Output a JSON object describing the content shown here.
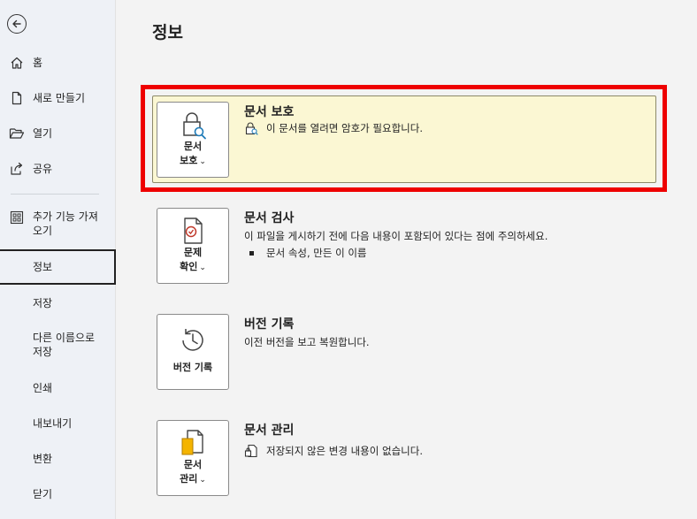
{
  "sidebar": {
    "items": [
      {
        "label": "홈",
        "icon": "home-icon"
      },
      {
        "label": "새로 만들기",
        "icon": "new-document-icon"
      },
      {
        "label": "열기",
        "icon": "open-folder-icon"
      },
      {
        "label": "공유",
        "icon": "share-icon"
      },
      {
        "label": "추가 기능 가져오기",
        "line1": "추가 기능 가져",
        "line2": "오기",
        "icon": "add-ins-icon"
      },
      {
        "label": "정보"
      },
      {
        "label": "저장"
      },
      {
        "label": "다른 이름으로 저장",
        "line1": "다른 이름으로",
        "line2": "저장"
      },
      {
        "label": "인쇄"
      },
      {
        "label": "내보내기"
      },
      {
        "label": "변환"
      },
      {
        "label": "닫기"
      }
    ]
  },
  "main": {
    "title": "정보",
    "sections": [
      {
        "title": "문서 보호",
        "description": "이 문서를 열려면 암호가 필요합니다.",
        "tile_line1": "문서",
        "tile_line2": "보호",
        "icon": "lock-icon",
        "highlighted": true
      },
      {
        "title": "문서 검사",
        "description": "이 파일을 게시하기 전에 다음 내용이 포함되어 있다는 점에 주의하세요.",
        "bullet": "문서 속성, 만든 이 이름",
        "tile_line1": "문제",
        "tile_line2": "확인",
        "icon": "inspect-document-icon"
      },
      {
        "title": "버전 기록",
        "description": "이전 버전을 보고 복원합니다.",
        "tile_line1": "버전 기록",
        "icon": "history-icon"
      },
      {
        "title": "문서 관리",
        "description": "저장되지 않은 변경 내용이 없습니다.",
        "tile_line1": "문서",
        "tile_line2": "관리",
        "icon": "manage-document-icon"
      }
    ]
  },
  "colors": {
    "highlight_bg": "#fbf7d3",
    "red_frame": "#ee0000",
    "sidebar_bg": "#eef1f6"
  }
}
